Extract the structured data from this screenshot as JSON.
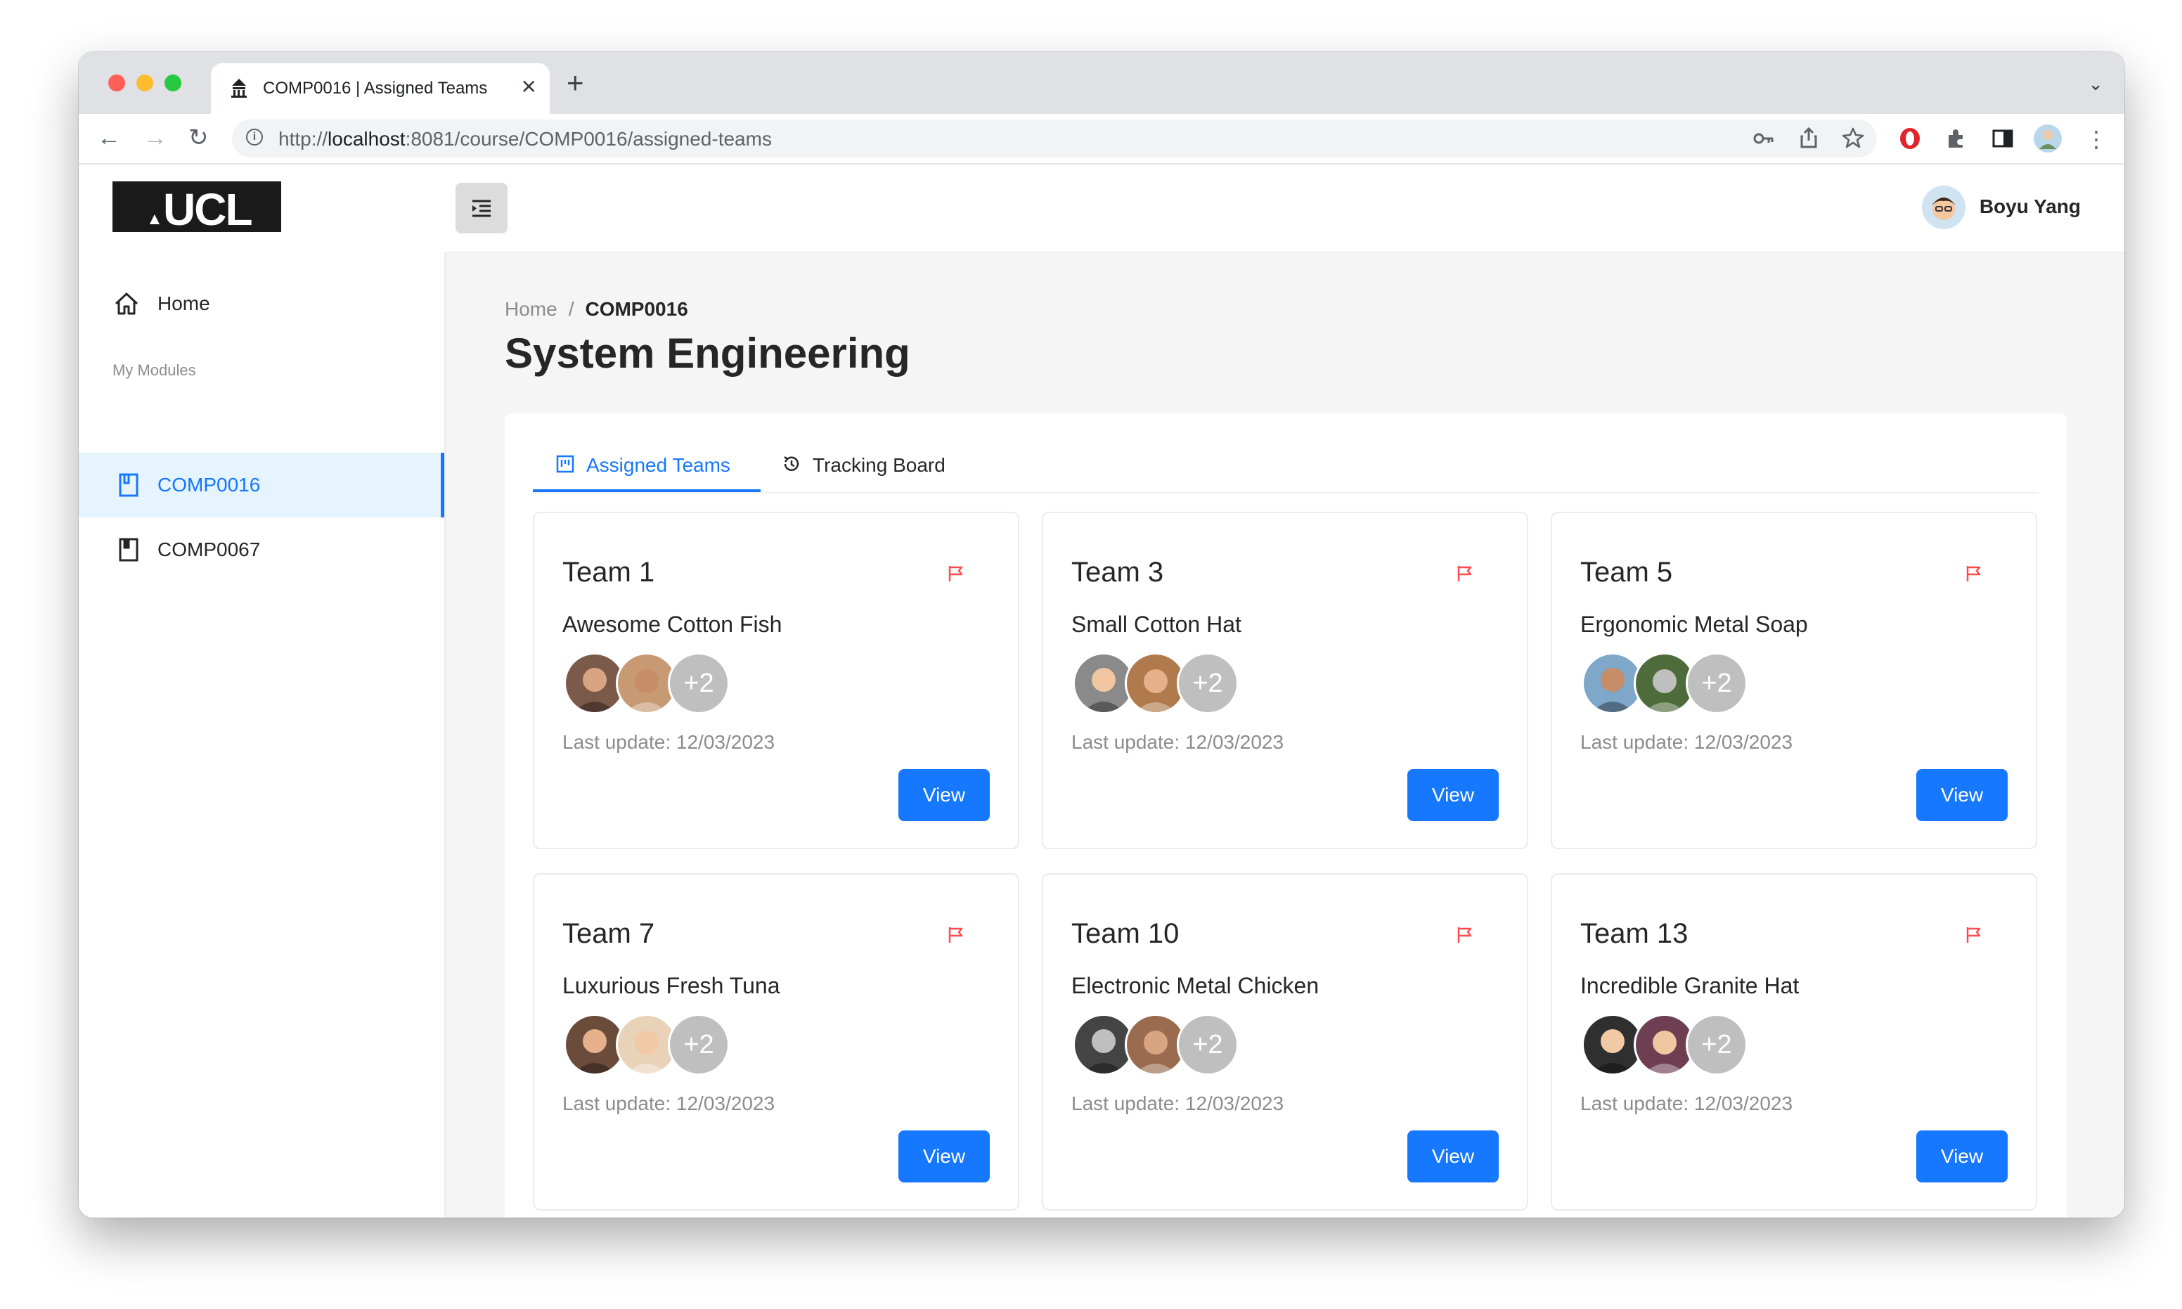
{
  "browser": {
    "tab_title": "COMP0016 | Assigned Teams",
    "url_prefix": "http://",
    "url_host": "localhost",
    "url_path": ":8081/course/COMP0016/assigned-teams"
  },
  "sidebar": {
    "logo_text": "UCL",
    "home_label": "Home",
    "group_label": "My Modules",
    "modules": [
      {
        "label": "COMP0016",
        "active": true
      },
      {
        "label": "COMP0067",
        "active": false
      }
    ]
  },
  "header": {
    "user_name": "Boyu Yang"
  },
  "breadcrumb": {
    "home": "Home",
    "separator": "/",
    "current": "COMP0016"
  },
  "page": {
    "title": "System Engineering"
  },
  "tabs": [
    {
      "label": "Assigned Teams",
      "active": true
    },
    {
      "label": "Tracking Board",
      "active": false
    }
  ],
  "teams": [
    {
      "name": "Team 1",
      "project": "Awesome Cotton Fish",
      "more": "+2",
      "update": "Last update: 12/03/2023",
      "button": "View"
    },
    {
      "name": "Team 3",
      "project": "Small Cotton Hat",
      "more": "+2",
      "update": "Last update: 12/03/2023",
      "button": "View"
    },
    {
      "name": "Team 5",
      "project": "Ergonomic Metal Soap",
      "more": "+2",
      "update": "Last update: 12/03/2023",
      "button": "View"
    },
    {
      "name": "Team 7",
      "project": "Luxurious Fresh Tuna",
      "more": "+2",
      "update": "Last update: 12/03/2023",
      "button": "View"
    },
    {
      "name": "Team 10",
      "project": "Electronic Metal Chicken",
      "more": "+2",
      "update": "Last update: 12/03/2023",
      "button": "View"
    },
    {
      "name": "Team 13",
      "project": "Incredible Granite Hat",
      "more": "+2",
      "update": "Last update: 12/03/2023",
      "button": "View"
    }
  ],
  "colors": {
    "primary": "#1677ff",
    "flag": "#ff4d4f",
    "active_menu_bg": "#e6f4ff"
  }
}
